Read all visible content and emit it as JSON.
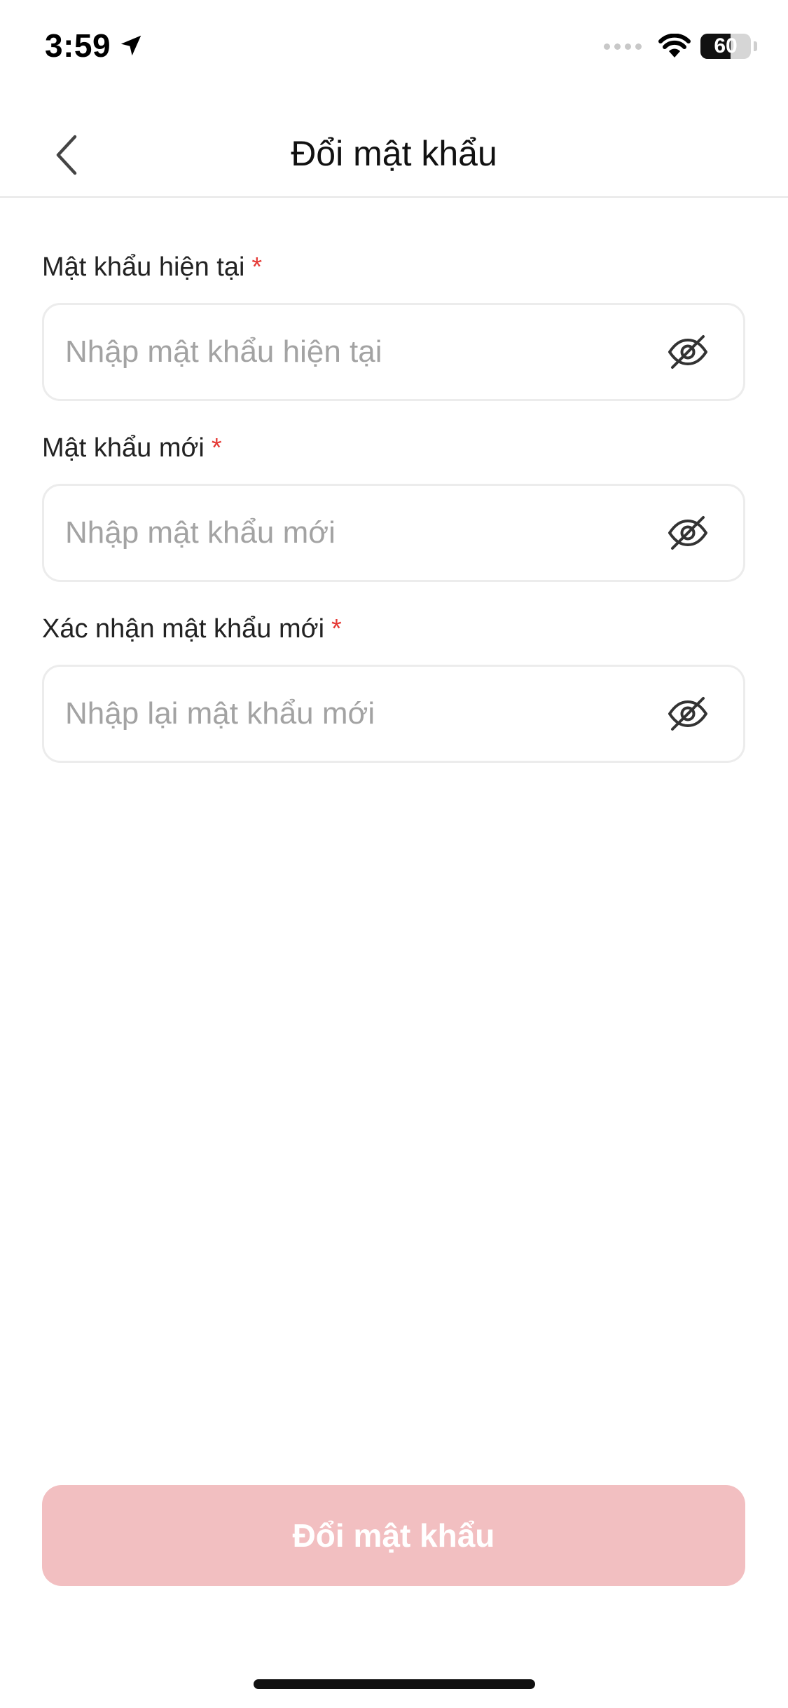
{
  "status_bar": {
    "time": "3:59",
    "battery_level": "60",
    "battery_fraction": 0.6
  },
  "header": {
    "title": "Đổi mật khẩu"
  },
  "form": {
    "fields": [
      {
        "label": "Mật khẩu hiện tại",
        "required_mark": "*",
        "placeholder": "Nhập mật khẩu hiện tại",
        "value": ""
      },
      {
        "label": "Mật khẩu mới",
        "required_mark": "*",
        "placeholder": "Nhập mật khẩu mới",
        "value": ""
      },
      {
        "label": "Xác nhận mật khẩu mới",
        "required_mark": "*",
        "placeholder": "Nhập lại mật khẩu mới",
        "value": ""
      }
    ]
  },
  "submit": {
    "label": "Đổi mật khẩu",
    "enabled": false
  },
  "icons": {
    "back": "chevron-left-icon",
    "visibility": "eye-off-icon",
    "location": "location-arrow-icon",
    "wifi": "wifi-icon"
  },
  "colors": {
    "required": "#e53935",
    "button_disabled_bg": "#f2bfc1",
    "button_text": "#ffffff",
    "border": "#ececec",
    "placeholder": "#a3a3a3"
  }
}
